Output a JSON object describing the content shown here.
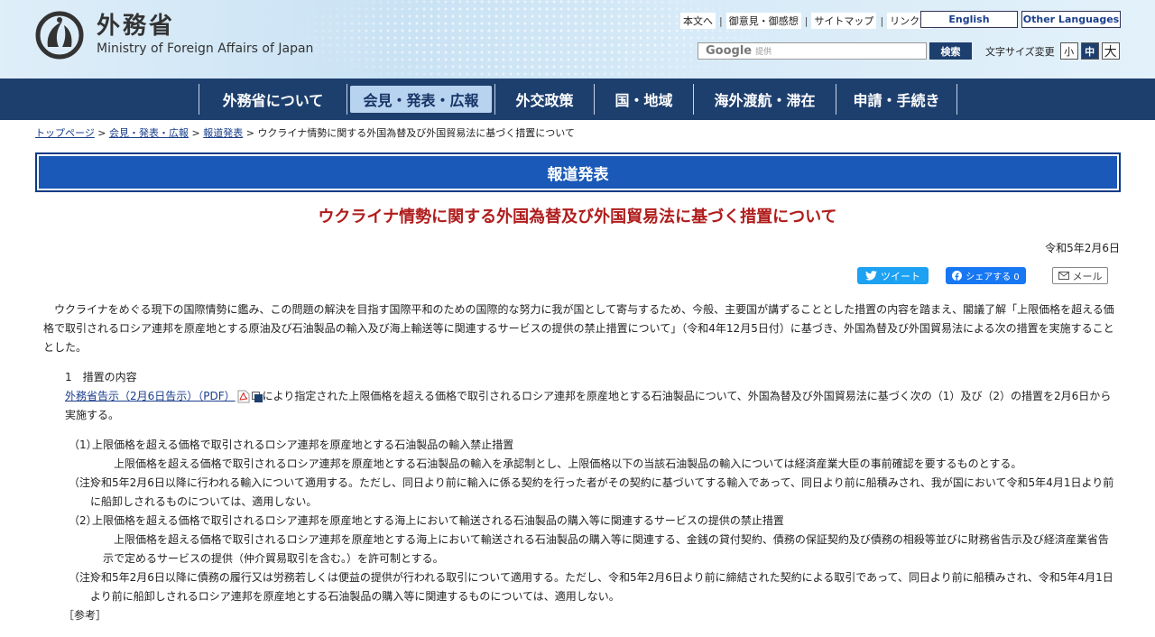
{
  "header": {
    "logo_jp": "外務省",
    "logo_en": "Ministry of Foreign Affairs of Japan",
    "top_links": [
      "本文へ",
      "御意見・御感想",
      "サイトマップ",
      "リンク集"
    ],
    "english": "English",
    "other_languages": "Other Languages",
    "search_brand": "Google",
    "search_sub": "提供",
    "search_button": "検索",
    "font_size_label": "文字サイズ変更",
    "font_sizes": [
      "小",
      "中",
      "大"
    ],
    "font_size_selected": "中"
  },
  "nav": {
    "items": [
      "外務省について",
      "会見・発表・広報",
      "外交政策",
      "国・地域",
      "海外渡航・滞在",
      "申請・手続き"
    ],
    "active": "会見・発表・広報"
  },
  "breadcrumb": {
    "links": [
      "トップページ",
      "会見・発表・広報",
      "報道発表"
    ],
    "separator": ">",
    "current": "ウクライナ情勢に関する外国為替及び外国貿易法に基づく措置について"
  },
  "banner": "報道発表",
  "page_title": "ウクライナ情勢に関する外国為替及び外国貿易法に基づく措置について",
  "date": "令和5年2月6日",
  "share": {
    "tweet": "ツイート",
    "facebook": "シェアする 0",
    "mail": "メール"
  },
  "content": {
    "intro": "ウクライナをめぐる現下の国際情勢に鑑み、この問題の解決を目指す国際平和のための国際的な努力に我が国として寄与するため、今般、主要国が講ずることとした措置の内容を踏まえ、閣議了解「上限価格を超える価格で取引されるロシア連邦を原産地とする原油及び石油製品の輸入及び海上輸送等に関連するサービスの提供の禁止措置について」（令和4年12月5日付）に基づき、外国為替及び外国貿易法による次の措置を実施することとした。",
    "section1_heading": "1　措置の内容",
    "section1_link": "外務省告示（2月6日告示）（PDF）",
    "section1_text": "により指定された上限価格を超える価格で取引されるロシア連邦を原産地とする石油製品について、外国為替及び外国貿易法に基づく次の（1）及び（2）の措置を2月6日から実施する。",
    "item1_label": "（1）",
    "item1_heading": "上限価格を超える価格で取引されるロシア連邦を原産地とする石油製品の輸入禁止措置",
    "item1_body": "上限価格を超える価格で取引されるロシア連邦を原産地とする石油製品の輸入を承認制とし、上限価格以下の当該石油製品の輸入については経済産業大臣の事前確認を要するものとする。",
    "note1_label": "（注）",
    "note1_text": "令和5年2月6日以降に行われる輸入について適用する。ただし、同日より前に輸入に係る契約を行った者がその契約に基づいてする輸入であって、同日より前に船積みされ、我が国において令和5年4月1日より前に船卸しされるものについては、適用しない。",
    "item2_label": "（2）",
    "item2_heading": "上限価格を超える価格で取引されるロシア連邦を原産地とする海上において輸送される石油製品の購入等に関連するサービスの提供の禁止措置",
    "item2_body": "上限価格を超える価格で取引されるロシア連邦を原産地とする海上において輸送される石油製品の購入等に関連する、金銭の貸付契約、債務の保証契約及び債務の相殺等並びに財務省告示及び経済産業省告示で定めるサービスの提供（仲介貿易取引を含む。）を許可制とする。",
    "note2_label": "（注）",
    "note2_text": "令和5年2月6日以降に債務の履行又は労務若しくは便益の提供が行われる取引について適用する。ただし、令和5年2月6日より前に締結された契約による取引であって、同日より前に船積みされ、令和5年4月1日より前に船卸しされるロシア連邦を原産地とする石油製品の購入等に関連するものについては、適用しない。",
    "reference": "［参考］"
  },
  "colors": {
    "nav_bg": "#1d3f6e",
    "nav_active_bg": "#b8d3ef",
    "banner_bg": "#1a59b7",
    "title_red": "#b01c1c",
    "link_blue": "#1a3e8c"
  }
}
